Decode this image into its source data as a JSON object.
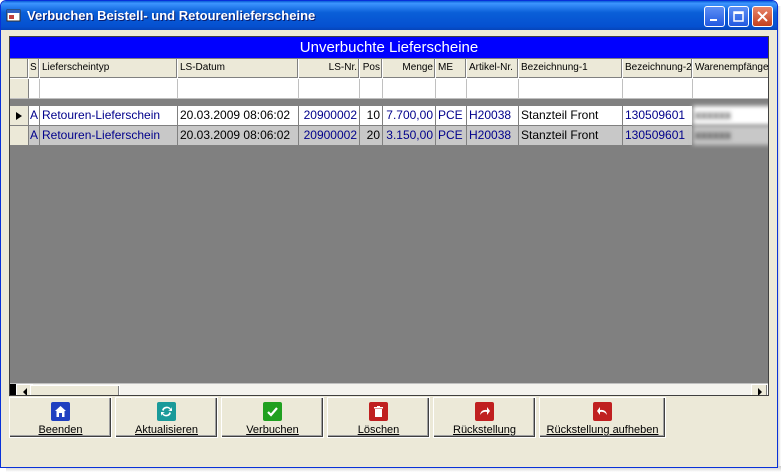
{
  "window": {
    "title": "Verbuchen Beistell- und Retourenlieferscheine"
  },
  "grid": {
    "caption": "Unverbuchte Lieferscheine",
    "columns": [
      "S",
      "Lieferscheintyp",
      "LS-Datum",
      "LS-Nr.",
      "Pos",
      "Menge",
      "ME",
      "Artikel-Nr.",
      "Bezeichnung-1",
      "Bezeichnung-2",
      "Warenempfänger"
    ],
    "rows": [
      {
        "s": "A",
        "typ": "Retouren-Lieferschein",
        "datum": "20.03.2009 08:06:02",
        "nr": "20900002",
        "pos": "10",
        "menge": "7.700,00",
        "me": "PCE",
        "artikel": "H20038",
        "bez1": "Stanzteil Front",
        "bez2": "130509601",
        "empf": "xxxxxx"
      },
      {
        "s": "A",
        "typ": "Retouren-Lieferschein",
        "datum": "20.03.2009 08:06:02",
        "nr": "20900002",
        "pos": "20",
        "menge": "3.150,00",
        "me": "PCE",
        "artikel": "H20038",
        "bez1": "Stanzteil Front",
        "bez2": "130509601",
        "empf": "xxxxxx"
      }
    ]
  },
  "buttons": {
    "beenden": "Beenden",
    "aktualisieren": "Aktualisieren",
    "verbuchen": "Verbuchen",
    "loeschen": "Löschen",
    "rueckstellung": "Rückstellung",
    "rueckstellung_aufheben": "Rückstellung aufheben"
  },
  "colors": {
    "caption_bg": "#0000ff",
    "titlebar": "#0a5fd8",
    "data_text": "#00008b"
  }
}
